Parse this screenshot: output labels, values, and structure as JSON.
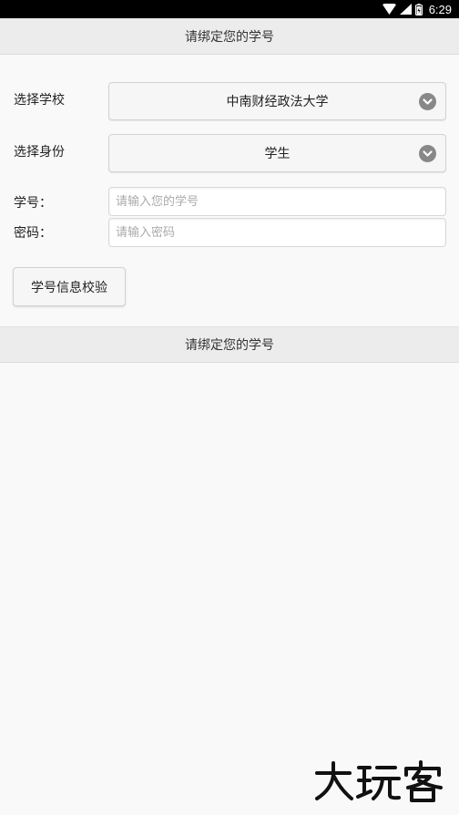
{
  "status_bar": {
    "time": "6:29",
    "icons": [
      "wifi-icon",
      "signal-icon",
      "battery-icon"
    ]
  },
  "header_top": {
    "title": "请绑定您的学号"
  },
  "form": {
    "school": {
      "label": "选择学校",
      "selected": "中南财经政法大学"
    },
    "identity": {
      "label": "选择身份",
      "selected": "学生"
    },
    "student_id": {
      "label": "学号：",
      "placeholder": "请输入您的学号",
      "value": ""
    },
    "password": {
      "label": "密码：",
      "placeholder": "请输入密码",
      "value": ""
    },
    "verify_button": "学号信息校验"
  },
  "header_bottom": {
    "title": "请绑定您的学号"
  },
  "watermark": {
    "text": "大玩客"
  },
  "colors": {
    "status_bar_bg": "#000000",
    "header_bg": "#ececec",
    "page_bg": "#f9f9f9",
    "select_arrow": "#888888"
  }
}
